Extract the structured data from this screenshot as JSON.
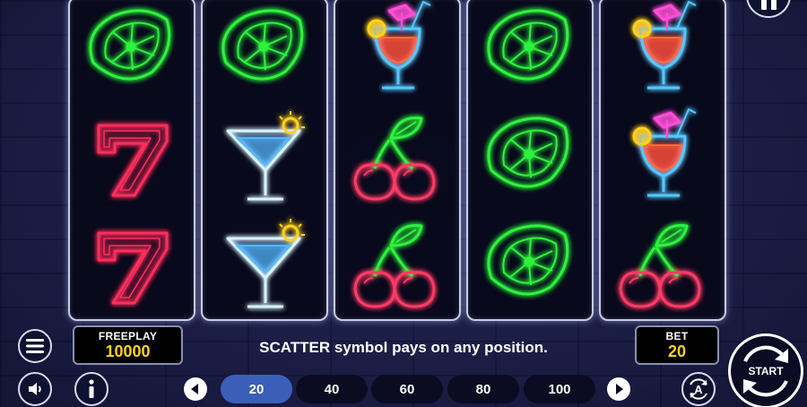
{
  "reels": [
    [
      "lime",
      "seven",
      "seven"
    ],
    [
      "lime",
      "martini",
      "martini"
    ],
    [
      "cocktail",
      "cherry",
      "cherry"
    ],
    [
      "lime",
      "lime",
      "lime"
    ],
    [
      "cocktail",
      "cocktail",
      "cherry"
    ]
  ],
  "freeplay": {
    "label": "FREEPLAY",
    "value": "10000"
  },
  "bet": {
    "label": "BET",
    "value": "20"
  },
  "message": "SCATTER symbol pays on any position.",
  "bet_options": [
    "20",
    "40",
    "60",
    "80",
    "100"
  ],
  "selected_bet": "20",
  "start_label": "START",
  "auto_label": "A",
  "colors": {
    "lime": "#2df23c",
    "seven": "#ff2f5c",
    "cherry": "#ff3a66",
    "leaf": "#2df23c",
    "glass": "#d7f4ff",
    "cocktail_liquid": "#ff6a3a",
    "accent_blue": "#3b5fb8",
    "gold": "#ffd21e"
  },
  "icons": [
    "menu-icon",
    "sound-icon",
    "info-icon",
    "prev-arrow-icon",
    "next-arrow-icon",
    "autoplay-icon",
    "pause-icon",
    "start-spin-icon"
  ]
}
